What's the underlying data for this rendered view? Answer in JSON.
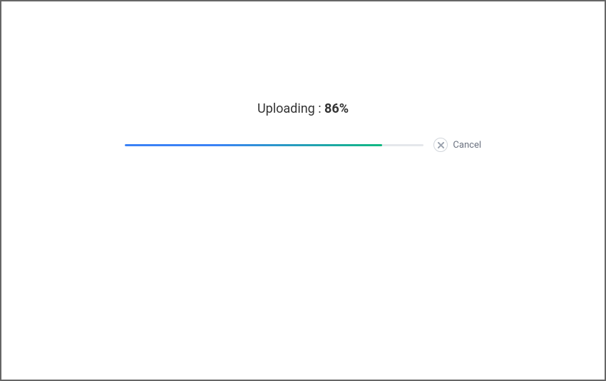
{
  "upload": {
    "status_label": "Uploading : ",
    "percent_value": 86,
    "percent_text": "86%",
    "progress_width": "86%",
    "cancel_label": "Cancel",
    "colors": {
      "gradient_start": "#3b82f6",
      "gradient_end": "#10b981",
      "track": "#e5e7eb"
    }
  }
}
